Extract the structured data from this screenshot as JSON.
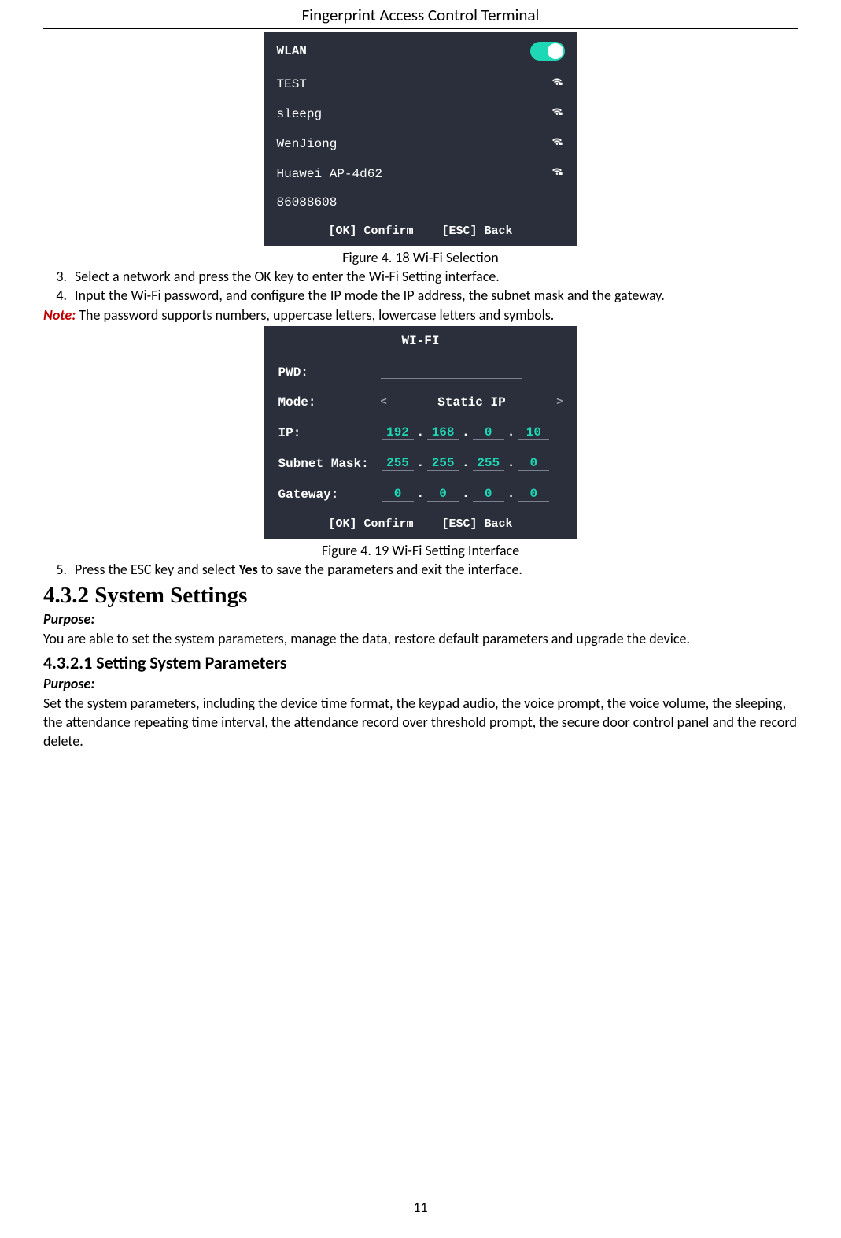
{
  "header": "Fingerprint Access Control Terminal",
  "page_number": "11",
  "screen1": {
    "wlan_label": "WLAN",
    "networks": [
      "TEST",
      "sleepg",
      "WenJiong",
      "Huawei AP-4d62",
      "86088608"
    ],
    "footer_ok": "[OK] Confirm",
    "footer_esc": "[ESC] Back"
  },
  "caption1": "Figure 4. 18  Wi-Fi Selection",
  "steps": {
    "s3_num": "3.",
    "s3_text": "Select a network and press the OK key to enter the Wi-Fi Setting interface.",
    "s4_num": "4.",
    "s4_text": "Input the Wi-Fi password, and configure the IP mode the IP address, the subnet mask and the gateway.",
    "note_label": "Note:",
    "note_text": " The password supports numbers, uppercase letters, lowercase letters and symbols."
  },
  "screen2": {
    "title": "WI-FI",
    "pwd_label": "PWD:",
    "mode_label": "Mode:",
    "mode_value": "Static IP",
    "ip_label": "IP:",
    "ip": [
      "192",
      "168",
      "0",
      "10"
    ],
    "subnet_label": "Subnet Mask:",
    "subnet": [
      "255",
      "255",
      "255",
      "0"
    ],
    "gateway_label": "Gateway:",
    "gateway": [
      "0",
      "0",
      "0",
      "0"
    ],
    "footer_ok": "[OK] Confirm",
    "footer_esc": "[ESC] Back"
  },
  "caption2": "Figure 4. 19  Wi-Fi Setting Interface",
  "steps2": {
    "s5_num": "5.",
    "s5_pre": "Press the ESC key and select ",
    "s5_bold": "Yes",
    "s5_post": " to save the parameters and exit the interface."
  },
  "section": {
    "h2": "4.3.2   System Settings",
    "purpose_label": "Purpose:",
    "purpose_text": "You are able to set the system parameters, manage the data, restore default parameters and upgrade the device.",
    "h3": "4.3.2.1 Setting System Parameters",
    "purpose2_label": "Purpose:",
    "purpose2_text": "Set the system parameters, including the device time format, the keypad audio, the voice prompt, the voice volume, the sleeping, the attendance repeating time interval, the attendance record over threshold prompt, the secure door control panel and the record delete."
  }
}
